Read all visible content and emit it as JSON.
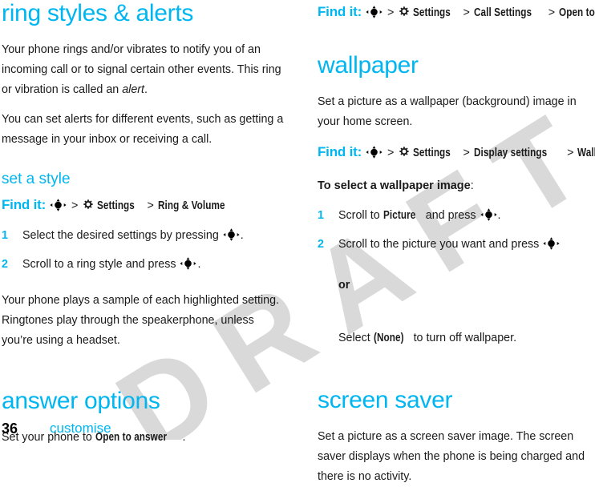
{
  "document": {
    "watermark": "DRAFT",
    "accent_color": "#00b6f0",
    "watermark_color": "#d9d9d9"
  },
  "footer": {
    "page_number": "36",
    "chapter": "customise"
  },
  "icons": {
    "nav_key": "five-way-navigation-key-icon",
    "settings_gear": "gear-icon"
  },
  "left_column": {
    "title": "ring styles & alerts",
    "intro_1": "Your phone rings and/or vibrates to notify you of an incoming call or to signal certain other events. This ring or vibration is called an ",
    "intro_1_em": "alert",
    "intro_1_tail": ".",
    "intro_2": "You can set alerts for different events, such as getting a message in your inbox or receiving a call.",
    "set_a_style": {
      "heading": "set a style",
      "find_it_label": "Find it:",
      "path": [
        "Settings",
        "Ring & Volume"
      ],
      "steps": [
        {
          "num": "1",
          "pre": "Select the desired settings by pressing ",
          "post": "."
        },
        {
          "num": "2",
          "pre": "Scroll to a ring style and press ",
          "post": "."
        }
      ],
      "note": "Your phone plays a sample of each highlighted setting. Ringtones play through the speakerphone, unless you’re using a headset."
    },
    "answer_options": {
      "heading": "answer options",
      "lead_pre": "Set your phone to ",
      "lead_ui": "Open to answer",
      "lead_post": "."
    }
  },
  "right_column": {
    "answer_options_find_it": {
      "find_it_label": "Find it:",
      "path": [
        "Settings",
        "Call Settings",
        "Open to Answer"
      ]
    },
    "wallpaper": {
      "heading": "wallpaper",
      "body": "Set a picture as a wallpaper (background) image in your home screen.",
      "find_it_label": "Find it:",
      "path": [
        "Settings",
        "Display settings",
        "Wallpaper"
      ],
      "lead_bold": "To select a wallpaper image",
      "lead_bold_tail": ":",
      "steps": [
        {
          "num": "1",
          "pre": "Scroll to ",
          "ui": "Picture",
          "mid": " and press ",
          "post": "."
        },
        {
          "num": "2",
          "pre": "Scroll to the picture you want and press ",
          "ui": "",
          "mid": "",
          "post": ""
        }
      ],
      "or_label": "or",
      "alt_pre": "Select ",
      "alt_ui": "(None)",
      "alt_post": " to turn off wallpaper."
    },
    "screen_saver": {
      "heading": "screen saver",
      "body": "Set a picture as a screen saver image. The screen saver displays when the phone is being charged and there is no activity."
    }
  }
}
